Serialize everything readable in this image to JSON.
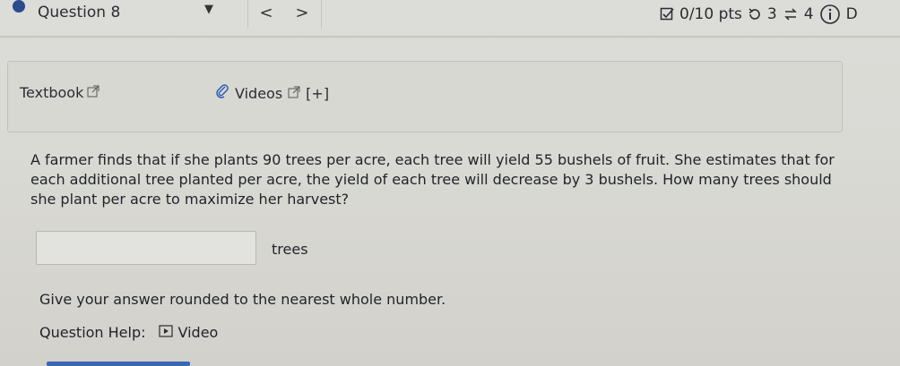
{
  "header": {
    "title": "Question 8",
    "score": "0/10 pts",
    "retries": "3",
    "attempts": "4",
    "overflow_letter": "D"
  },
  "resources": {
    "textbook_label": "Textbook",
    "videos_label": "Videos",
    "videos_expand": "[+]"
  },
  "question": {
    "text": "A farmer finds that if she plants 90 trees per acre, each tree will yield 55 bushels of fruit. She estimates that for each additional tree planted per acre, the yield of each tree will decrease by 3 bushels. How many trees should she plant per acre to maximize her harvest?",
    "answer_value": "",
    "units": "trees",
    "hint": "Give your answer rounded to the nearest whole number."
  },
  "help": {
    "label": "Question Help:",
    "video_label": "Video"
  }
}
